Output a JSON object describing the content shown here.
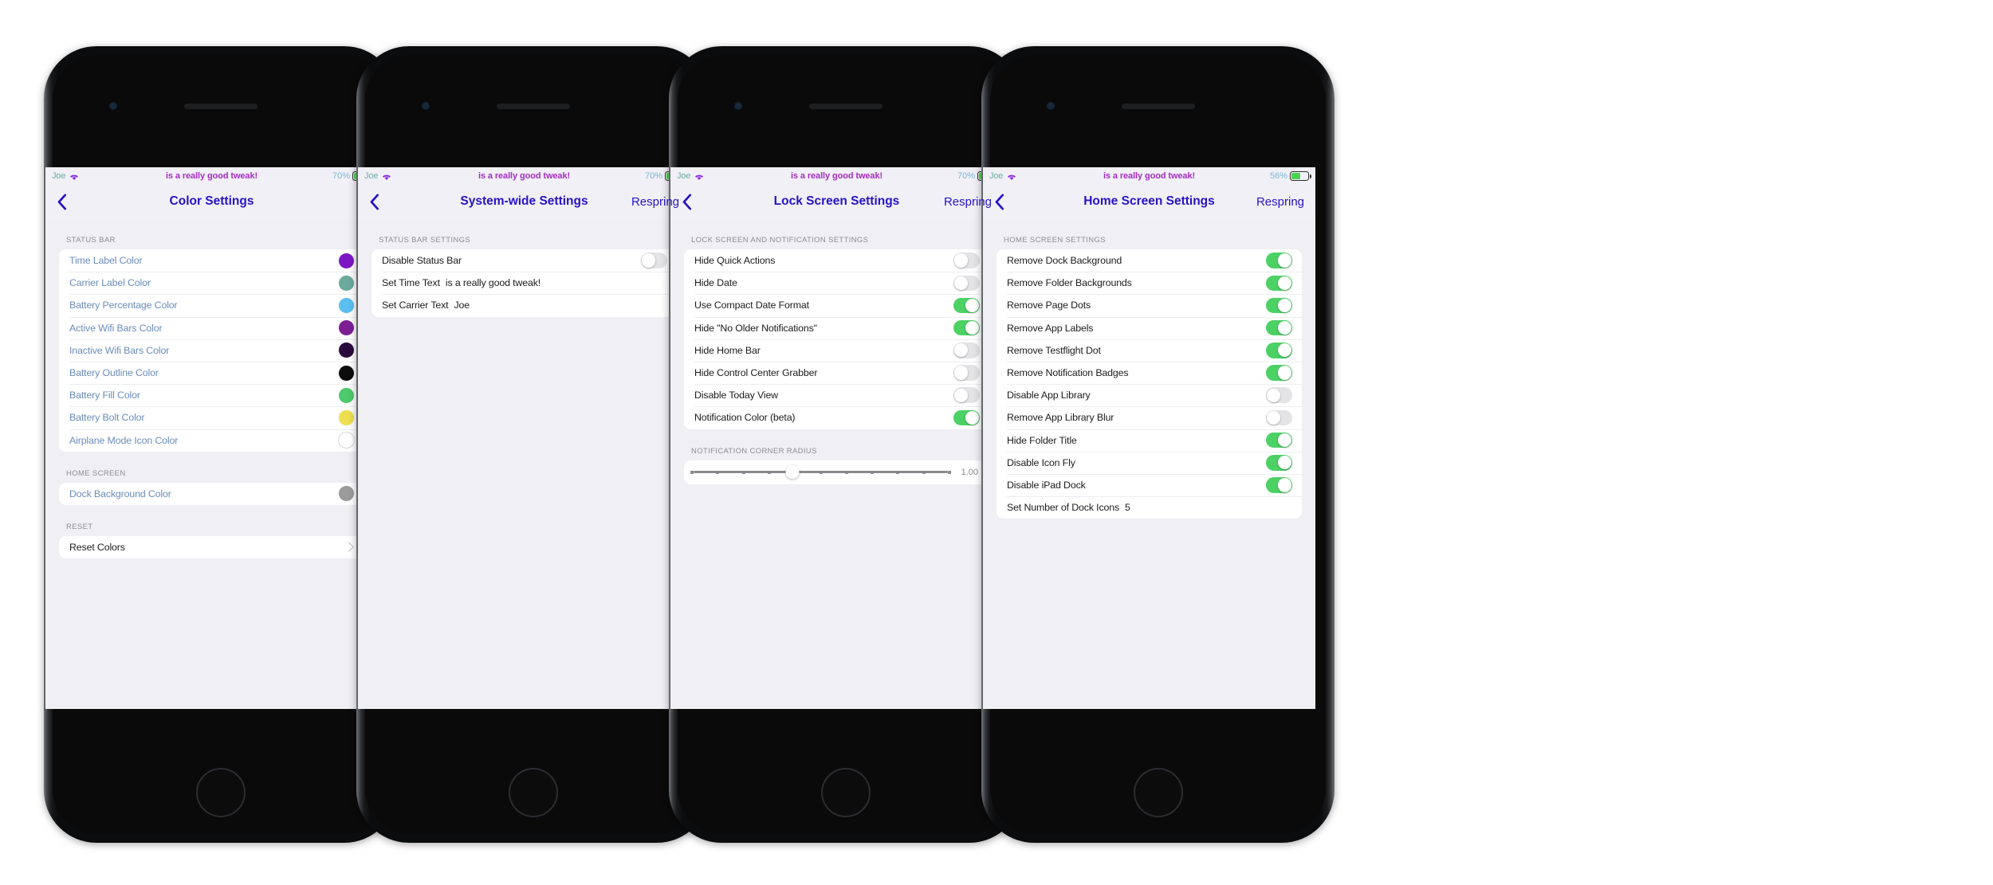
{
  "theme": {
    "accent_blue": "#2712c6",
    "link_blue": "#6b8cbb",
    "toggle_on_green": "#4cd164",
    "toggle_off_gray": "#e4e4e6",
    "screen_bg": "#efeff4",
    "card_bg": "#ffffff",
    "section_header_gray": "#8c8c93",
    "status_carrier_teal": "#6ab0a6",
    "status_center_purple": "#a52cc4",
    "status_pct_blue": "#79b7d8",
    "battery_green": "#4cd354"
  },
  "phones": [
    {
      "id": "phone-color-settings",
      "status_bar": {
        "carrier": "Joe",
        "wifi_icon": "wifi-icon",
        "center_text": "is a really good tweak!",
        "battery_percent": "70%",
        "battery_level": 70
      },
      "nav": {
        "back_icon": "chevron-left-icon",
        "title": "Color Settings",
        "right_label": ""
      },
      "sections": [
        {
          "header": "STATUS BAR",
          "rows": [
            {
              "type": "color",
              "label": "Time Label Color",
              "style": "link",
              "color": "#7c17c4"
            },
            {
              "type": "color",
              "label": "Carrier Label Color",
              "style": "link",
              "color": "#6aaa9c"
            },
            {
              "type": "color",
              "label": "Battery Percentage Color",
              "style": "link",
              "color": "#5bc0f0"
            },
            {
              "type": "color",
              "label": "Active Wifi Bars Color",
              "style": "link",
              "color": "#7b1f93"
            },
            {
              "type": "color",
              "label": "Inactive Wifi Bars Color",
              "style": "link",
              "color": "#2b0a3d"
            },
            {
              "type": "color",
              "label": "Battery Outline Color",
              "style": "link",
              "color": "#0c0c0c"
            },
            {
              "type": "color",
              "label": "Battery Fill Color",
              "style": "link",
              "color": "#4cc96a"
            },
            {
              "type": "color",
              "label": "Battery Bolt Color",
              "style": "link",
              "color": "#ece050"
            },
            {
              "type": "color",
              "label": "Airplane Mode Icon Color",
              "style": "link",
              "color": "#ffffff"
            }
          ]
        },
        {
          "header": "HOME SCREEN",
          "rows": [
            {
              "type": "color",
              "label": "Dock Background Color",
              "style": "link",
              "color": "#9b9b9b"
            }
          ]
        },
        {
          "header": "RESET",
          "rows": [
            {
              "type": "disclosure",
              "label": "Reset Colors",
              "style": "plain"
            }
          ]
        }
      ]
    },
    {
      "id": "phone-system-wide-settings",
      "status_bar": {
        "carrier": "Joe",
        "wifi_icon": "wifi-icon",
        "center_text": "is a really good tweak!",
        "battery_percent": "70%",
        "battery_level": 70
      },
      "nav": {
        "back_icon": "chevron-left-icon",
        "title": "System-wide Settings",
        "right_label": "Respring"
      },
      "sections": [
        {
          "header": "STATUS BAR SETTINGS",
          "rows": [
            {
              "type": "toggle",
              "label": "Disable Status Bar",
              "on": false
            },
            {
              "type": "value",
              "label": "Set Time Text",
              "value": "is a really good tweak!"
            },
            {
              "type": "value",
              "label": "Set Carrier Text",
              "value": "Joe"
            }
          ]
        }
      ]
    },
    {
      "id": "phone-lock-screen-settings",
      "status_bar": {
        "carrier": "Joe",
        "wifi_icon": "wifi-icon",
        "center_text": "is a really good tweak!",
        "battery_percent": "70%",
        "battery_level": 70
      },
      "nav": {
        "back_icon": "chevron-left-icon",
        "title": "Lock Screen Settings",
        "right_label": "Respring"
      },
      "sections": [
        {
          "header": "LOCK SCREEN AND NOTIFICATION SETTINGS",
          "rows": [
            {
              "type": "toggle",
              "label": "Hide Quick Actions",
              "on": false
            },
            {
              "type": "toggle",
              "label": "Hide Date",
              "on": false
            },
            {
              "type": "toggle",
              "label": "Use Compact Date Format",
              "on": true
            },
            {
              "type": "toggle",
              "label": "Hide \"No Older Notifications\"",
              "on": true
            },
            {
              "type": "toggle",
              "label": "Hide Home Bar",
              "on": false
            },
            {
              "type": "toggle",
              "label": "Hide Control Center Grabber",
              "on": false
            },
            {
              "type": "toggle",
              "label": "Disable Today View",
              "on": false
            },
            {
              "type": "toggle",
              "label": "Notification Color (beta)",
              "on": true
            }
          ]
        },
        {
          "header": "NOTIFICATION CORNER RADIUS",
          "rows": [
            {
              "type": "slider",
              "label": "",
              "value": "1.00",
              "position_pct": 39,
              "ticks": 11
            }
          ]
        }
      ]
    },
    {
      "id": "phone-home-screen-settings",
      "status_bar": {
        "carrier": "Joe",
        "wifi_icon": "wifi-icon",
        "center_text": "is a really good tweak!",
        "battery_percent": "56%",
        "battery_level": 56
      },
      "nav": {
        "back_icon": "chevron-left-icon",
        "title": "Home Screen Settings",
        "right_label": "Respring"
      },
      "sections": [
        {
          "header": "HOME SCREEN SETTINGS",
          "rows": [
            {
              "type": "toggle",
              "label": "Remove Dock Background",
              "on": true
            },
            {
              "type": "toggle",
              "label": "Remove Folder Backgrounds",
              "on": true
            },
            {
              "type": "toggle",
              "label": "Remove Page Dots",
              "on": true
            },
            {
              "type": "toggle",
              "label": "Remove App Labels",
              "on": true
            },
            {
              "type": "toggle",
              "label": "Remove Testflight Dot",
              "on": true
            },
            {
              "type": "toggle",
              "label": "Remove Notification Badges",
              "on": true
            },
            {
              "type": "toggle",
              "label": "Disable App Library",
              "on": false
            },
            {
              "type": "toggle",
              "label": "Remove App Library Blur",
              "on": false
            },
            {
              "type": "toggle",
              "label": "Hide Folder Title",
              "on": true
            },
            {
              "type": "toggle",
              "label": "Disable Icon Fly",
              "on": true
            },
            {
              "type": "toggle",
              "label": "Disable iPad Dock",
              "on": true
            },
            {
              "type": "value",
              "label": "Set Number of Dock Icons",
              "value": "5"
            }
          ]
        }
      ]
    }
  ]
}
